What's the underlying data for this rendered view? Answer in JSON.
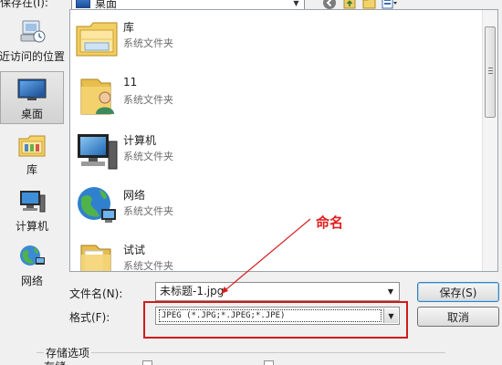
{
  "toolbar": {
    "save_in_label": "保存在(I):",
    "location_value": "桌面"
  },
  "nav": {
    "items": [
      {
        "label": "近访问的位置",
        "icon": "recent-places-icon"
      },
      {
        "label": "桌面",
        "icon": "desktop-icon",
        "selected": true
      },
      {
        "label": "库",
        "icon": "libraries-icon"
      },
      {
        "label": "计算机",
        "icon": "computer-icon"
      },
      {
        "label": "网络",
        "icon": "network-icon"
      }
    ]
  },
  "files": [
    {
      "name": "库",
      "type": "系统文件夹",
      "icon": "libraries-folder-icon"
    },
    {
      "name": "11",
      "type": "系统文件夹",
      "icon": "user-folder-icon"
    },
    {
      "name": "计算机",
      "type": "系统文件夹",
      "icon": "computer-icon"
    },
    {
      "name": "网络",
      "type": "系统文件夹",
      "icon": "network-globe-icon"
    },
    {
      "name": "试试",
      "type": "系统文件夹",
      "icon": "folder-icon"
    }
  ],
  "form": {
    "filename_label": "文件名(N):",
    "filename_value": "未标题-1.jpg",
    "format_label": "格式(F):",
    "format_value": "JPEG (*.JPG;*.JPEG;*.JPE)",
    "save_button": "保存(S)",
    "cancel_button": "取消"
  },
  "annotation": {
    "text": "命名",
    "color": "#e02020"
  },
  "storage": {
    "title": "存储选项",
    "cut_label": "存储"
  }
}
